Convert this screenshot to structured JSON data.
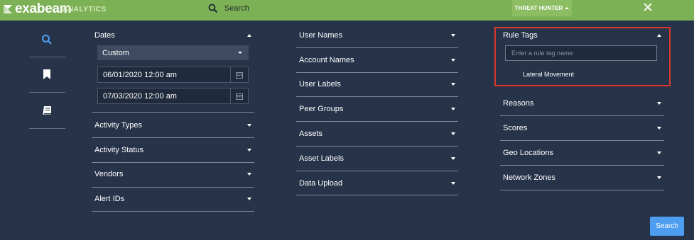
{
  "topbar": {
    "logo_text": "exabeam",
    "logo_sub": "ANALYTICS",
    "search_label": "Search",
    "threat_hunter_label": "THREAT HUNTER",
    "close_symbol": "✕"
  },
  "sidebar": {
    "items": [
      {
        "icon": "search-icon",
        "active": true
      },
      {
        "icon": "bookmark-icon",
        "active": false
      },
      {
        "icon": "book-icon",
        "active": false
      }
    ]
  },
  "col1": {
    "dates_label": "Dates",
    "date_range_select": "Custom",
    "start_date": "06/01/2020 12:00 am",
    "end_date": "07/03/2020 12:00 am",
    "sections": [
      "Activity Types",
      "Activity Status",
      "Vendors",
      "Alert IDs"
    ]
  },
  "col2": {
    "sections": [
      "User Names",
      "Account Names",
      "User Labels",
      "Peer Groups",
      "Assets",
      "Asset Labels",
      "Data Upload"
    ]
  },
  "col3": {
    "rule_tags_label": "Rule Tags",
    "rule_tag_placeholder": "Enter a rule tag name",
    "rule_tag_suggestion": "Lateral Movement",
    "sections": [
      "Reasons",
      "Scores",
      "Geo Locations",
      "Network Zones"
    ]
  },
  "actions": {
    "search_button": "Search"
  },
  "colors": {
    "topbar": "#7db155",
    "background": "#263349",
    "accent_blue": "#4d9ef0",
    "highlight_red": "#d9362c"
  }
}
